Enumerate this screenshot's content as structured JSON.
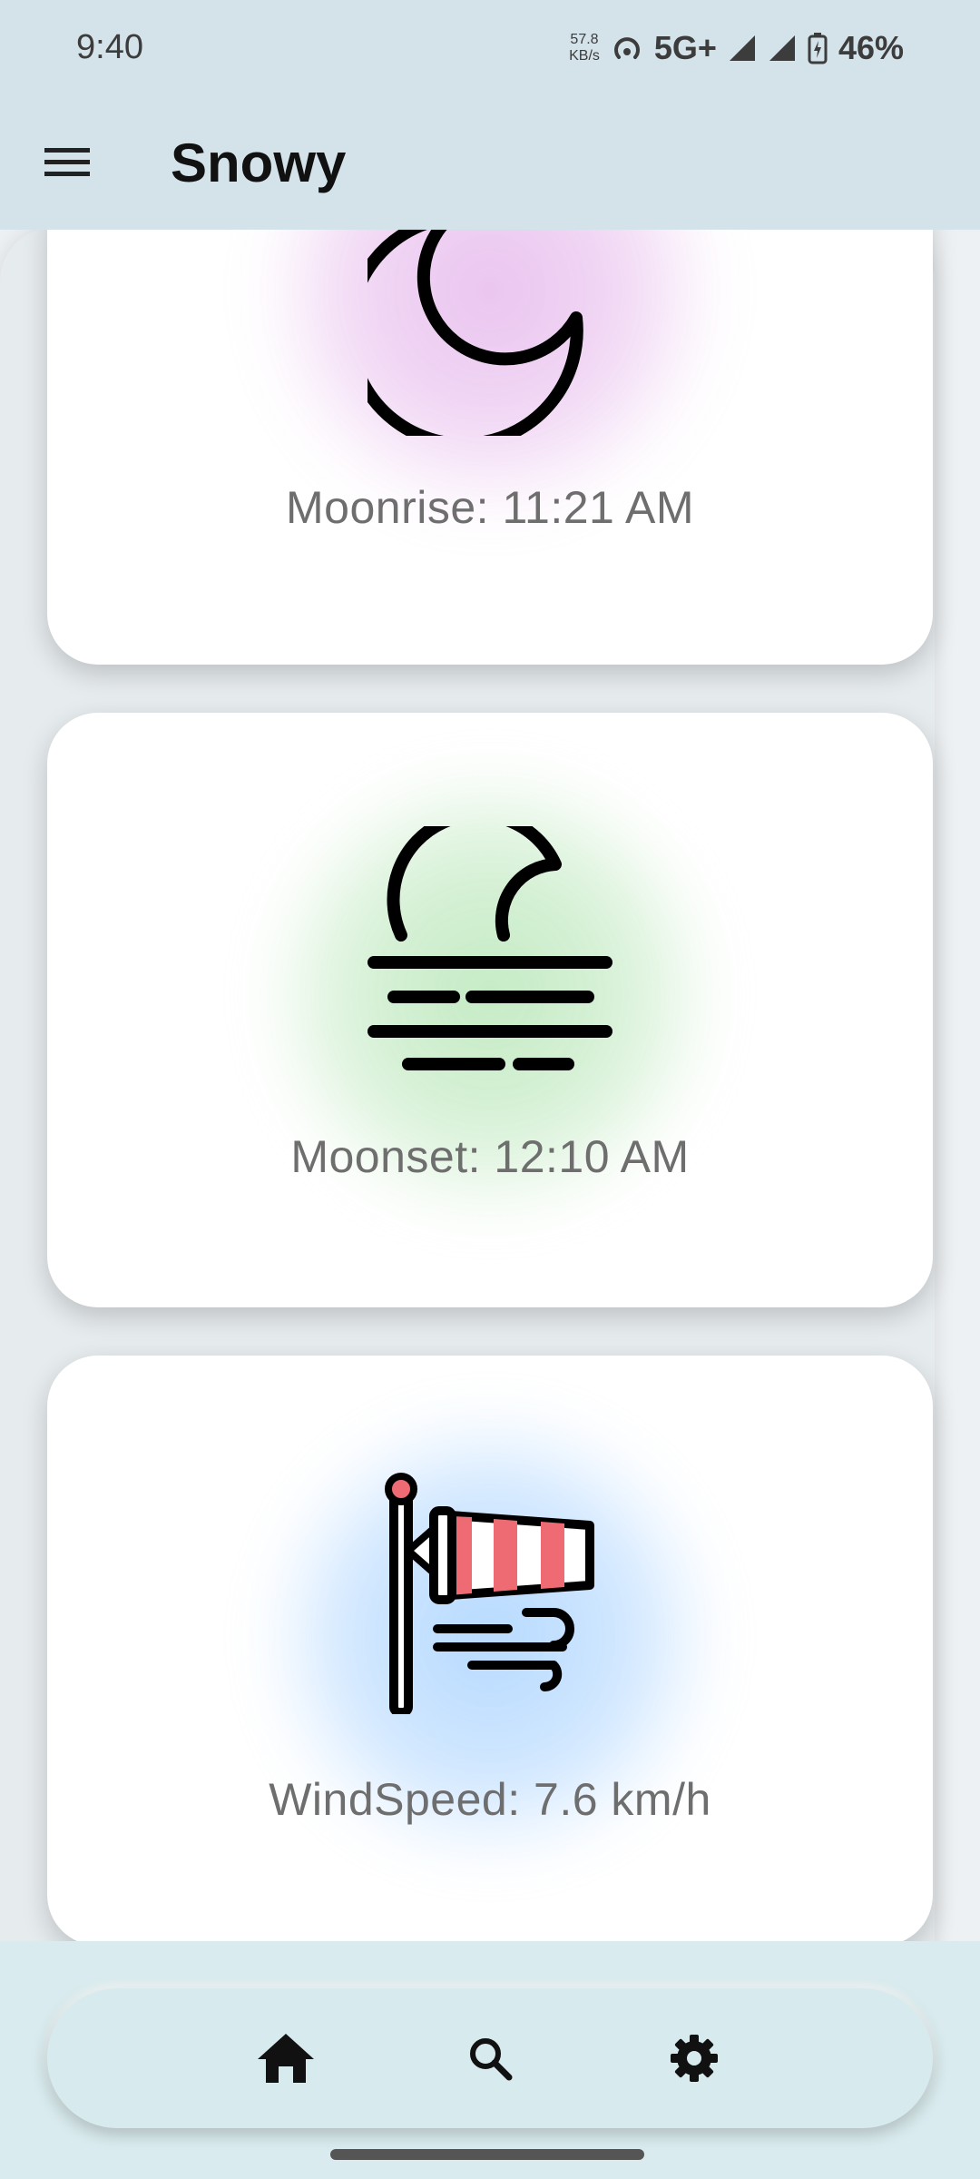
{
  "status_bar": {
    "time": "9:40",
    "net_speed_value": "57.8",
    "net_speed_unit": "KB/s",
    "network_type": "5G+",
    "battery": "46%"
  },
  "app_bar": {
    "title": "Snowy",
    "menu_icon": "menu-icon"
  },
  "cards": {
    "moonrise": {
      "label": "Moonrise: 11:21 AM",
      "icon": "moon-crescent-icon",
      "glow_color": "#e6b8ec"
    },
    "moonset": {
      "label": "Moonset: 12:10 AM",
      "icon": "moonset-icon",
      "glow_color": "#b8e6b8"
    },
    "wind": {
      "label": "WindSpeed: 7.6 km/h",
      "icon": "windsock-icon",
      "glow_color": "#a8d2ff"
    }
  },
  "bottom_nav": {
    "items": [
      {
        "name": "home",
        "icon": "home-icon"
      },
      {
        "name": "search",
        "icon": "search-icon"
      },
      {
        "name": "settings",
        "icon": "gear-icon"
      }
    ]
  }
}
